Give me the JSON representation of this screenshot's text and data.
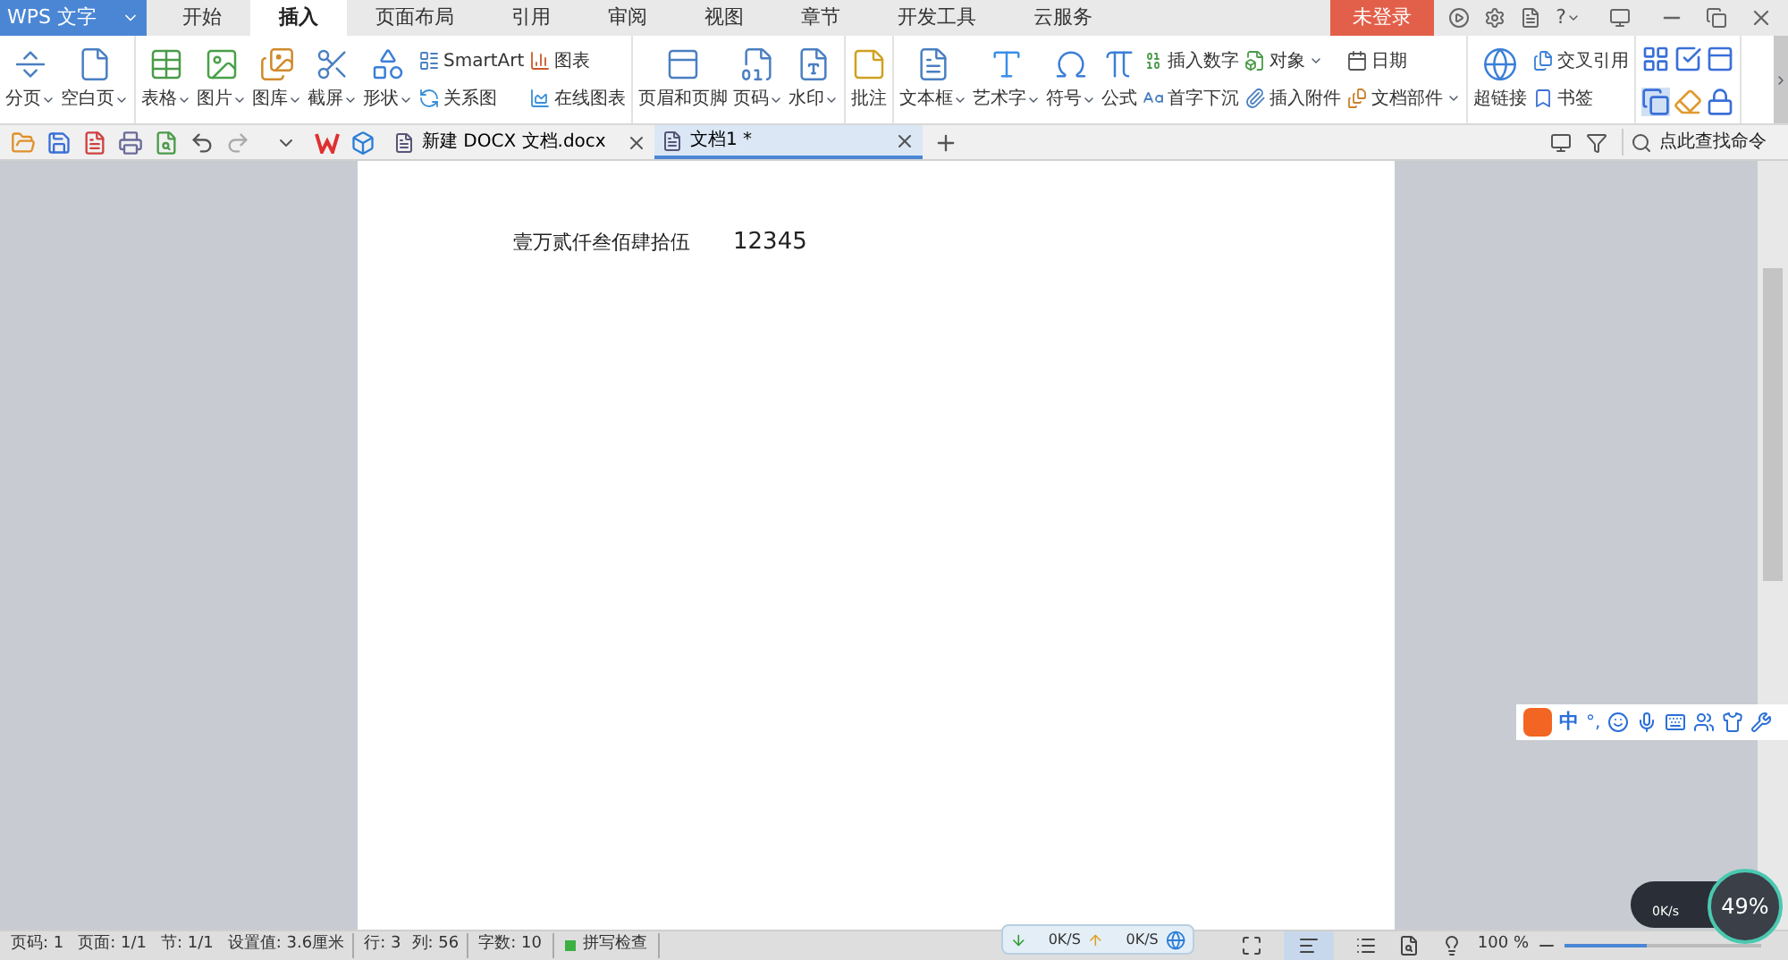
{
  "app_menu": {
    "label": "WPS 文字"
  },
  "tabs": [
    {
      "label": "开始",
      "selected": false
    },
    {
      "label": "插入",
      "selected": true
    },
    {
      "label": "页面布局",
      "selected": false
    },
    {
      "label": "引用",
      "selected": false
    },
    {
      "label": "审阅",
      "selected": false
    },
    {
      "label": "视图",
      "selected": false
    },
    {
      "label": "章节",
      "selected": false
    },
    {
      "label": "开发工具",
      "selected": false
    },
    {
      "label": "云服务",
      "selected": false
    }
  ],
  "login_button": {
    "label": "未登录"
  },
  "help_label": "?",
  "ribbon": {
    "groups": [
      {
        "columns": [
          {
            "kind": "large",
            "label": "分页",
            "dropdown": true
          },
          {
            "kind": "large",
            "label": "空白页",
            "dropdown": true
          }
        ]
      },
      {
        "columns": [
          {
            "kind": "large",
            "label": "表格",
            "dropdown": true
          },
          {
            "kind": "large",
            "label": "图片",
            "dropdown": true
          },
          {
            "kind": "large",
            "label": "图库",
            "dropdown": true
          },
          {
            "kind": "large",
            "label": "截屏",
            "dropdown": true
          },
          {
            "kind": "large",
            "label": "形状",
            "dropdown": true
          },
          {
            "kind": "stack",
            "items": [
              {
                "label": "SmartArt",
                "dropdown": false
              },
              {
                "label": "关系图",
                "dropdown": false
              }
            ]
          },
          {
            "kind": "stack",
            "items": [
              {
                "label": "图表",
                "dropdown": false
              },
              {
                "label": "在线图表",
                "dropdown": false
              }
            ]
          }
        ]
      },
      {
        "columns": [
          {
            "kind": "large",
            "label": "页眉和页脚",
            "dropdown": false
          },
          {
            "kind": "large",
            "label": "页码",
            "dropdown": true
          },
          {
            "kind": "large",
            "label": "水印",
            "dropdown": true
          }
        ]
      },
      {
        "columns": [
          {
            "kind": "large",
            "label": "批注",
            "dropdown": false
          }
        ]
      },
      {
        "columns": [
          {
            "kind": "large",
            "label": "文本框",
            "dropdown": true
          },
          {
            "kind": "large",
            "label": "艺术字",
            "dropdown": true
          },
          {
            "kind": "large",
            "label": "符号",
            "dropdown": true
          },
          {
            "kind": "large",
            "label": "公式",
            "dropdown": false
          },
          {
            "kind": "stack",
            "items": [
              {
                "label": "插入数字",
                "dropdown": false
              },
              {
                "label": "首字下沉",
                "dropdown": false
              }
            ]
          },
          {
            "kind": "stack",
            "items": [
              {
                "label": "对象",
                "dropdown": true
              },
              {
                "label": "插入附件",
                "dropdown": false
              }
            ]
          },
          {
            "kind": "stack",
            "items": [
              {
                "label": "日期",
                "dropdown": false
              },
              {
                "label": "文档部件",
                "dropdown": true
              }
            ]
          }
        ]
      },
      {
        "columns": [
          {
            "kind": "large",
            "label": "超链接",
            "dropdown": false
          },
          {
            "kind": "stack",
            "items": [
              {
                "label": "交叉引用",
                "dropdown": false
              },
              {
                "label": "书签",
                "dropdown": false
              }
            ]
          }
        ]
      },
      {
        "columns": [
          {
            "kind": "icons"
          }
        ]
      }
    ]
  },
  "doc_tabs": [
    {
      "label": "新建 DOCX 文档.docx",
      "selected": false
    },
    {
      "label": "文档1 *",
      "selected": true
    }
  ],
  "command_search": {
    "placeholder": "点此查找命令"
  },
  "document": {
    "lines": [
      {
        "text": "壹万贰仟叁佰肆拾伍",
        "value": "12345"
      }
    ]
  },
  "ime_toolbar": {
    "mode": "中",
    "punctuation": "°,"
  },
  "status_bar": {
    "items": [
      "页码: 1",
      "页面: 1/1",
      "节: 1/1",
      "设置值: 3.6厘米"
    ],
    "position": [
      "行: 3",
      "列: 56"
    ],
    "word_count": "字数: 10",
    "spell_check": {
      "label": "拼写检查",
      "on": true
    },
    "zoom": {
      "label": "100 %",
      "level": 0.42
    }
  },
  "network_widget": {
    "download": "0K/S",
    "upload": "0K/S"
  },
  "memory_widget": {
    "percent": "49%",
    "speed": "0K/s"
  }
}
